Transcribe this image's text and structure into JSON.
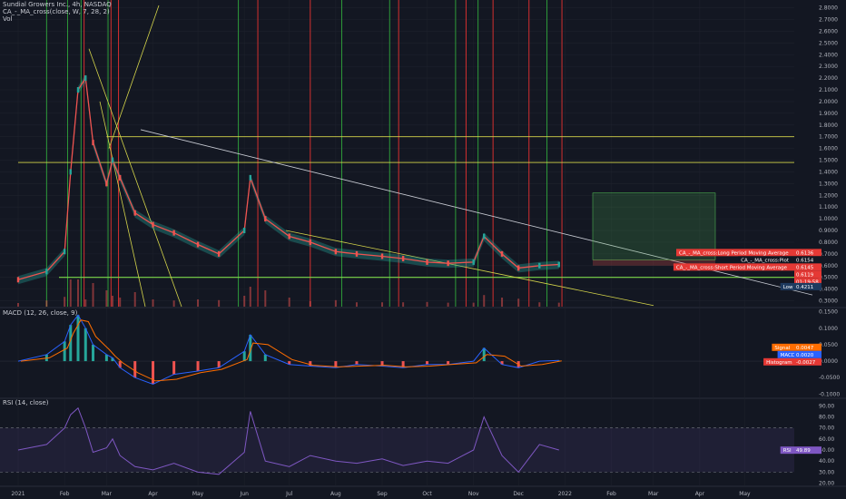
{
  "header": {
    "title": "Sundial Growers Inc., 4h, NASDAQ",
    "indicator": "CA_-_MA_cross(close, W, 7, 28, 2)",
    "vol": "Vol"
  },
  "colors": {
    "background": "#131722",
    "bull": "#26a69a",
    "bear": "#ef5350",
    "yellow": "#d4d44a",
    "green_line": "#7cd84a",
    "grid": "#1e222d",
    "macd": "#2962ff",
    "signal": "#ff6d00",
    "rsi": "#7e57c2"
  },
  "price_axis": {
    "ticks": [
      "2.8000",
      "2.7000",
      "2.6000",
      "2.5000",
      "2.4000",
      "2.3000",
      "2.2000",
      "2.1000",
      "2.0000",
      "1.9000",
      "1.8000",
      "1.7000",
      "1.6000",
      "1.5000",
      "1.4000",
      "1.3000",
      "1.2000",
      "1.1000",
      "1.0000",
      "0.9000",
      "0.8000",
      "0.7000",
      "0.6000",
      "0.5000",
      "0.4000",
      "0.3000"
    ],
    "min": 0.25,
    "max": 2.82
  },
  "price_tags": [
    {
      "label": "CA_-_MA_cross:Long Period Moving Average",
      "value": "0.6136",
      "kind": "red",
      "price": 0.6136
    },
    {
      "label": "CA_-_MA_cross:Plot",
      "value": "0.6154",
      "kind": "dark",
      "price": 0.6154
    },
    {
      "label": "CA_-_MA_cross:Short Period Moving Average",
      "value": "0.6145",
      "kind": "red",
      "price": 0.6145
    },
    {
      "label": "",
      "value": "0.6119",
      "kind": "red",
      "price": 0.6119
    },
    {
      "label": "",
      "value": "01:19:58",
      "kind": "red",
      "price": 0.6119
    },
    {
      "label": "Low",
      "value": "0.4211",
      "kind": "blue",
      "price": 0.4211
    }
  ],
  "macd": {
    "title": "MACD (12, 26, close, 9)",
    "ticks": [
      "0.1500",
      "0.1000",
      "0.0500",
      "0.0000",
      "-0.0500",
      "-0.1000"
    ],
    "min": -0.11,
    "max": 0.16,
    "tags": [
      {
        "label": "Signal",
        "value": "0.0047",
        "kind": "orange"
      },
      {
        "label": "MACD",
        "value": "0.0020",
        "kind": "blue"
      },
      {
        "label": "Histogram",
        "value": "-0.0027",
        "kind": "red"
      }
    ]
  },
  "rsi": {
    "title": "RSI (14, close)",
    "ticks": [
      "90.00",
      "80.00",
      "70.00",
      "60.00",
      "50.00",
      "40.00",
      "30.00",
      "20.00"
    ],
    "min": 18,
    "max": 96,
    "upper": 70,
    "lower": 30,
    "tag": {
      "label": "RSI",
      "value": "49.89"
    }
  },
  "time_axis": {
    "labels": [
      "2021",
      "Feb",
      "Mar",
      "Apr",
      "May",
      "Jun",
      "Jul",
      "Aug",
      "Sep",
      "Oct",
      "Nov",
      "Dec",
      "2022",
      "Feb",
      "Mar",
      "Apr",
      "May"
    ]
  },
  "chart_data": {
    "type": "line",
    "title": "Sundial Growers Inc., 4h, NASDAQ",
    "xlabel": "",
    "ylabel": "",
    "ylim": [
      0.25,
      2.82
    ],
    "x": [
      "2021-01-01",
      "2021-01-20",
      "2021-02-01",
      "2021-02-05",
      "2021-02-10",
      "2021-02-15",
      "2021-02-20",
      "2021-03-01",
      "2021-03-05",
      "2021-03-10",
      "2021-03-20",
      "2021-04-01",
      "2021-04-15",
      "2021-05-01",
      "2021-05-15",
      "2021-06-01",
      "2021-06-05",
      "2021-06-15",
      "2021-07-01",
      "2021-07-15",
      "2021-08-01",
      "2021-08-15",
      "2021-09-01",
      "2021-09-15",
      "2021-10-01",
      "2021-10-15",
      "2021-11-01",
      "2021-11-08",
      "2021-11-20",
      "2021-12-01",
      "2021-12-15",
      "2021-12-28"
    ],
    "series": [
      {
        "values": [
          0.48,
          0.55,
          0.72,
          1.4,
          2.1,
          2.2,
          1.65,
          1.3,
          1.5,
          1.35,
          1.05,
          0.95,
          0.88,
          0.78,
          0.7,
          0.9,
          1.35,
          1.0,
          0.85,
          0.8,
          0.72,
          0.7,
          0.68,
          0.66,
          0.63,
          0.62,
          0.63,
          0.85,
          0.7,
          0.58,
          0.6,
          0.61
        ]
      }
    ],
    "macd_series": [
      0.0,
      0.02,
      0.06,
      0.11,
      0.14,
      0.1,
      0.05,
      0.02,
      0.01,
      -0.02,
      -0.05,
      -0.07,
      -0.04,
      -0.03,
      -0.02,
      0.03,
      0.08,
      0.02,
      -0.01,
      -0.015,
      -0.02,
      -0.01,
      -0.015,
      -0.02,
      -0.01,
      -0.01,
      0.0,
      0.04,
      -0.01,
      -0.02,
      0.0,
      0.002
    ],
    "rsi_series": [
      50,
      55,
      70,
      82,
      88,
      70,
      48,
      52,
      60,
      45,
      35,
      32,
      38,
      30,
      28,
      48,
      85,
      40,
      35,
      45,
      40,
      38,
      42,
      36,
      40,
      38,
      50,
      80,
      45,
      30,
      55,
      50
    ]
  },
  "footer": {
    "range_label": ""
  }
}
